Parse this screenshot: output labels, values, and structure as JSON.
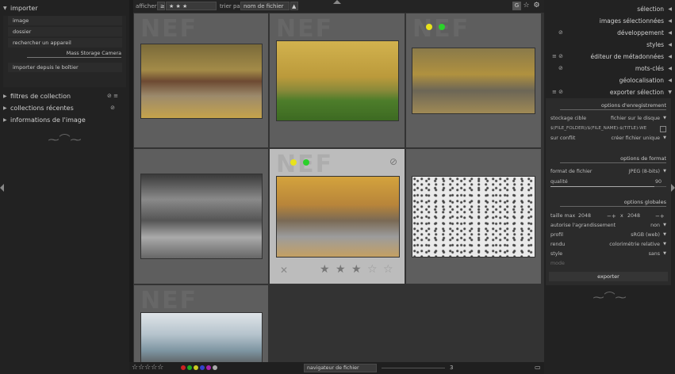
{
  "topbar": {
    "show_label": "afficher",
    "compare_op": "≥",
    "rating_filter": "★ ★ ★",
    "sort_label": "trier par",
    "sort_value": "nom de fichier",
    "sort_direction": "▲"
  },
  "left_panel": {
    "importer": {
      "title": "importer",
      "buttons": [
        "image",
        "dossier",
        "rechercher un appareil"
      ],
      "device": "Mass Storage Camera",
      "device_button": "importer depuis le boîtier"
    },
    "sections": [
      {
        "label": "filtres de collection"
      },
      {
        "label": "collections récentes"
      },
      {
        "label": "informations de l'image"
      }
    ]
  },
  "thumbnails": [
    {
      "label": "NEF",
      "colors": [],
      "selected": false,
      "palette": [
        "#6d5a2a",
        "#c8a43e"
      ]
    },
    {
      "label": "NEF",
      "colors": [],
      "selected": false,
      "palette": [
        "#c9a640",
        "#4f7a2a"
      ]
    },
    {
      "label": "NEF",
      "colors": [
        "#e8e21b",
        "#2bd12b"
      ],
      "selected": false,
      "palette": [
        "#a88a3c",
        "#6b6b55"
      ]
    },
    {
      "label": "",
      "colors": [],
      "selected": false,
      "palette": [
        "#555555",
        "#bbbbbb"
      ]
    },
    {
      "label": "NEF",
      "colors": [
        "#e8e21b",
        "#2bd12b"
      ],
      "selected": true,
      "stars": 3,
      "palette": [
        "#c59a35",
        "#8a8a8a"
      ]
    },
    {
      "label": "",
      "colors": [],
      "selected": false,
      "palette": [
        "#e9e9e9",
        "#333333"
      ]
    },
    {
      "label": "NEF",
      "colors": [],
      "selected": false,
      "palette": [
        "#cfd6dc",
        "#6c8796"
      ]
    }
  ],
  "bottombar": {
    "rating_stars": "☆☆☆☆☆",
    "color_labels": [
      "#cc2222",
      "#22aa22",
      "#cccc22",
      "#3344cc",
      "#aa22aa",
      "#aaaaaa"
    ],
    "view_selector": "navigateur de fichier",
    "zoom_value": "3"
  },
  "right_panel": {
    "sections": [
      {
        "label": "sélection",
        "icons": ""
      },
      {
        "label": "images sélectionnées",
        "icons": ""
      },
      {
        "label": "développement",
        "icons": "⊘"
      },
      {
        "label": "styles",
        "icons": ""
      },
      {
        "label": "éditeur de métadonnées",
        "icons": "≡ ⊘"
      },
      {
        "label": "mots-clés",
        "icons": "⊘"
      },
      {
        "label": "géolocalisation",
        "icons": ""
      },
      {
        "label": "exporter sélection",
        "icons": "≡ ⊘"
      }
    ],
    "export": {
      "storage_header": "options d'enregistrement",
      "storage_target_label": "stockage cible",
      "storage_target_value": "fichier sur le disque",
      "path_value": "$(FILE_FOLDER)/$(FILE_NAME)-$(TITLE)-WE",
      "conflict_label": "sur conflit",
      "conflict_value": "créer fichier unique",
      "format_header": "options de format",
      "format_label": "format de fichier",
      "format_value": "JPEG (8-bits)",
      "quality_label": "qualité",
      "quality_value": "90",
      "quality_fraction": 0.9,
      "global_header": "options globales",
      "max_size_label": "taille max",
      "max_width": "2048",
      "times": "x",
      "max_height": "2048",
      "upscale_label": "autorise l'agrandissement",
      "upscale_value": "non",
      "profile_label": "profil",
      "profile_value": "sRGB (web)",
      "intent_label": "rendu",
      "intent_value": "colorimétrie relative",
      "style_label": "style",
      "style_value": "sans",
      "mode_label": "mode",
      "export_button": "exporter"
    }
  }
}
